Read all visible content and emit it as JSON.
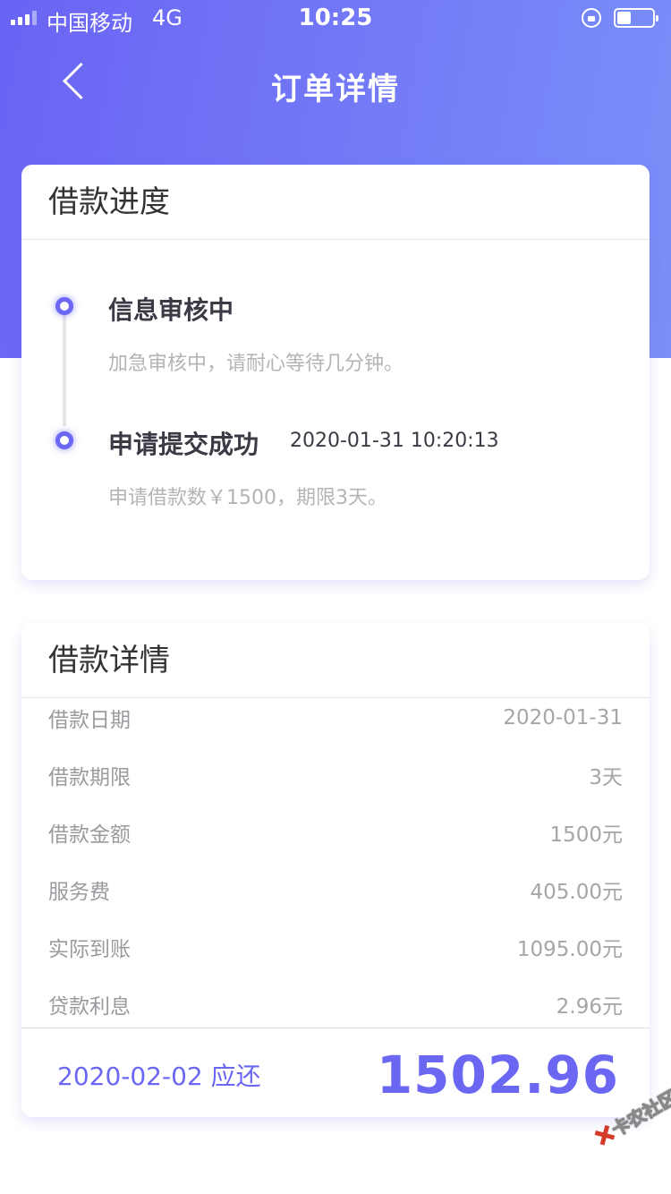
{
  "status_bar": {
    "carrier": "中国移动",
    "network": "4G",
    "time": "10:25"
  },
  "nav": {
    "title": "订单详情"
  },
  "progress": {
    "title": "借款进度",
    "steps": [
      {
        "title": "信息审核中",
        "time": "",
        "desc": "加急审核中，请耐心等待几分钟。"
      },
      {
        "title": "申请提交成功",
        "time": "2020-01-31 10:20:13",
        "desc": "申请借款数￥1500，期限3天。"
      }
    ]
  },
  "detail": {
    "title": "借款详情",
    "rows": [
      {
        "label": "借款日期",
        "value": "2020-01-31"
      },
      {
        "label": "借款期限",
        "value": "3天"
      },
      {
        "label": "借款金额",
        "value": "1500元"
      },
      {
        "label": "服务费",
        "value": "405.00元"
      },
      {
        "label": "实际到账",
        "value": "1095.00元"
      },
      {
        "label": "贷款利息",
        "value": "2.96元"
      }
    ],
    "due_text": "2020-02-02 应还",
    "due_amount": "1502.96"
  },
  "watermark": {
    "text": "卡农社区"
  },
  "colors": {
    "accent": "#6b67f2",
    "header_gradient_start": "#6a63f4",
    "header_gradient_end": "#7a8ff8"
  }
}
